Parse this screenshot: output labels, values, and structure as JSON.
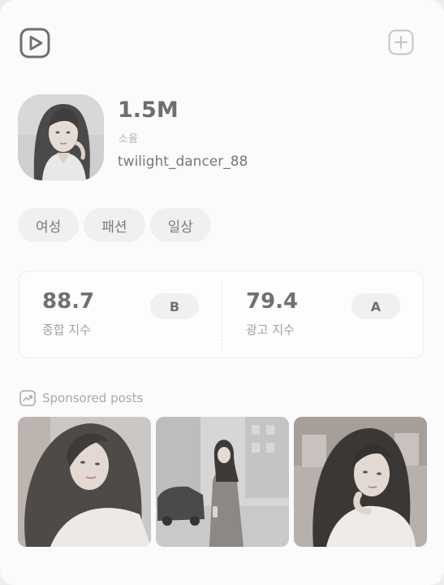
{
  "header": {
    "left_icon": "play-square-icon",
    "right_icon": "plus-square-icon"
  },
  "profile": {
    "followers": "1.5M",
    "real_name": "소율",
    "handle": "twilight_dancer_88",
    "avatar_icon": "profile-photo"
  },
  "tags": [
    {
      "label": "여성"
    },
    {
      "label": "패션"
    },
    {
      "label": "일상"
    }
  ],
  "stats": [
    {
      "value": "88.7",
      "label": "종합 지수",
      "grade": "B"
    },
    {
      "value": "79.4",
      "label": "광고 지수",
      "grade": "A"
    }
  ],
  "sponsored": {
    "title": "Sponsored posts",
    "icon": "trend-chart-icon",
    "posts": [
      {
        "icon": "sponsored-photo-1"
      },
      {
        "icon": "sponsored-photo-2"
      },
      {
        "icon": "sponsored-photo-3"
      }
    ]
  }
}
